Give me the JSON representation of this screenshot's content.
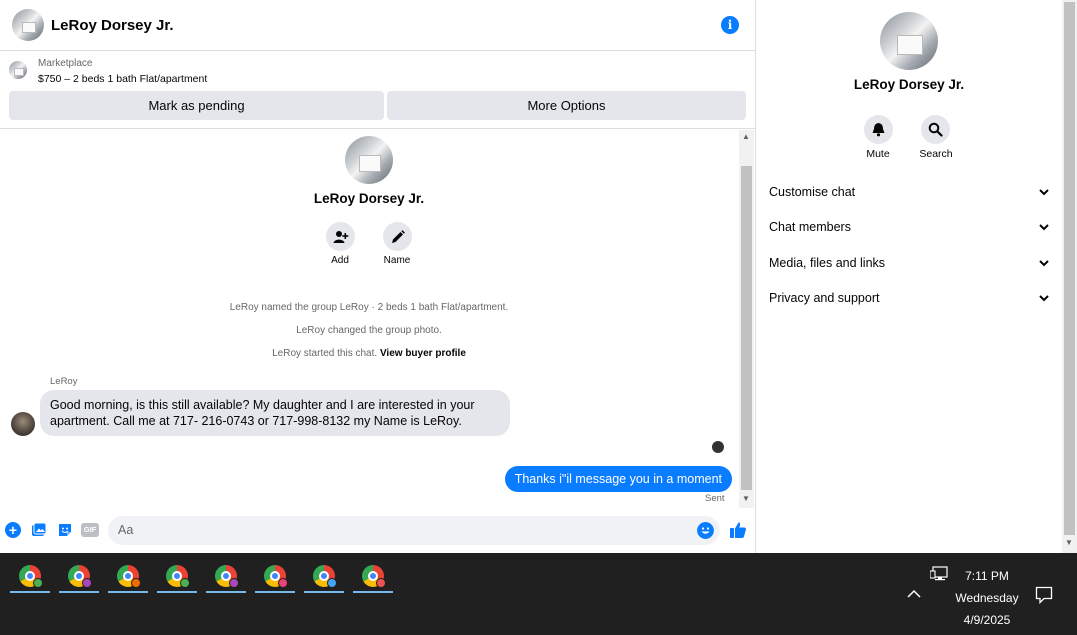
{
  "header": {
    "title": "LeRoy Dorsey Jr."
  },
  "marketplace": {
    "label": "Marketplace",
    "listing": "$750 – 2 beds 1 bath Flat/apartment",
    "pending_label": "Mark as pending",
    "more_label": "More Options"
  },
  "thread": {
    "profile_name": "LeRoy Dorsey Jr.",
    "add_label": "Add",
    "name_label": "Name",
    "system_messages": [
      "LeRoy named the group LeRoy · 2 beds 1 bath Flat/apartment.",
      "LeRoy changed the group photo.",
      "LeRoy started this chat."
    ],
    "view_profile_link": "View buyer profile",
    "sender_name": "LeRoy",
    "incoming_message": "Good morning, is this still available? My daughter and I are interested in your apartment. Call me at 717- 216-0743 or 717-998-8132 my Name is LeRoy.",
    "outgoing_message": "Thanks i\"il message you in a moment",
    "status": "Sent"
  },
  "composer": {
    "placeholder": "Aa",
    "gif_label": "GIF"
  },
  "details": {
    "name": "LeRoy Dorsey Jr.",
    "mute_label": "Mute",
    "search_label": "Search",
    "sections": [
      "Customise chat",
      "Chat members",
      "Media, files and links",
      "Privacy and support"
    ]
  },
  "taskbar": {
    "time": "7:11 PM",
    "day": "Wednesday",
    "date": "4/9/2025",
    "app_badges": [
      "#4caf50",
      "#ab47bc",
      "#ef6c00",
      "#4caf50",
      "#ab47bc",
      "#ec407a",
      "#42a5f5",
      "#ef5350"
    ]
  },
  "colors": {
    "accent": "#0a7cff",
    "bubble_in": "#e4e6eb",
    "taskbar": "#202020"
  }
}
